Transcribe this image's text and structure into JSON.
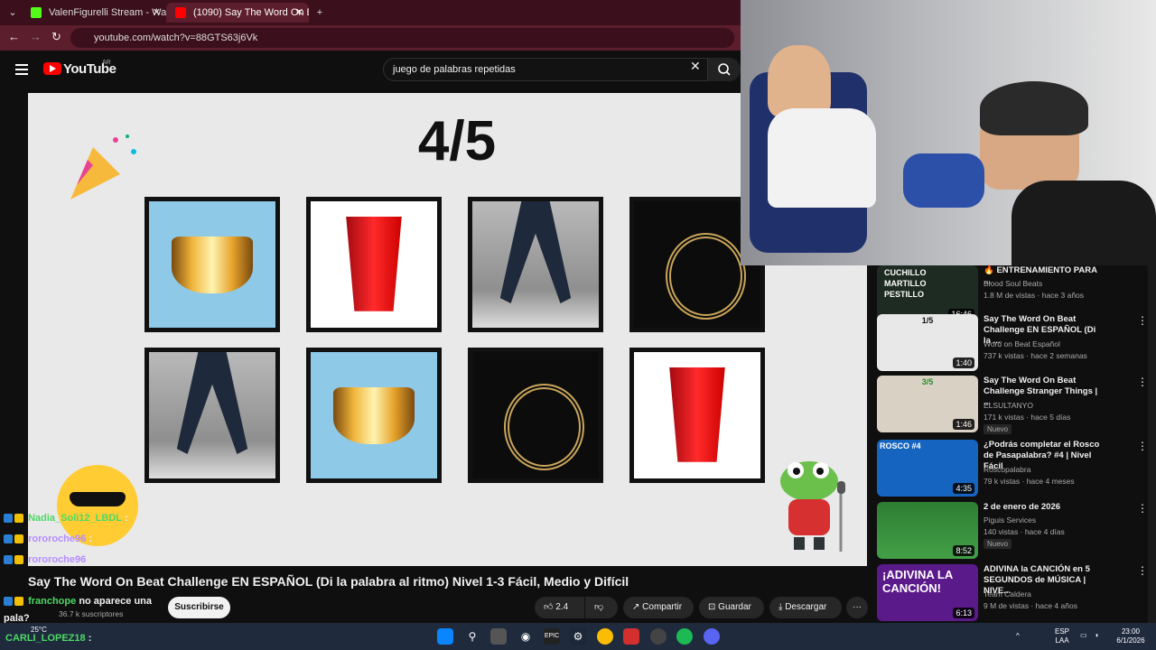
{
  "browser": {
    "tabs": [
      {
        "title": "ValenFigurelli Stream - Watch L"
      },
      {
        "title": "(1090) Say The Word On Be"
      }
    ],
    "new_tab": "+",
    "url": "youtube.com/watch?v=88GTS63j6Vk"
  },
  "youtube": {
    "logo": "YouTube",
    "region": "AR",
    "search_value": "juego de palabras repetidas"
  },
  "video": {
    "score": "4/5",
    "grid": [
      [
        "bowl",
        "cup",
        "walk",
        "rope"
      ],
      [
        "walk",
        "bowl",
        "rope",
        "cup"
      ]
    ]
  },
  "sidebar": {
    "items": [
      {
        "title": "🔥 ENTRENAMIENTO PARA ...",
        "channel": "Blood Soul Beats",
        "meta": "1.8 M de vistas · hace 3 años",
        "duration": "16:46",
        "thumb_text": "CUCHILLO MARTILLO PESTILLO",
        "new": ""
      },
      {
        "title": "Say The Word On Beat Challenge EN ESPAÑOL (Di la ...",
        "channel": "Word on Beat Español",
        "meta": "737 k vistas · hace 2 semanas",
        "duration": "1:40",
        "thumb_text": "1/5",
        "new": ""
      },
      {
        "title": "Say The Word On Beat Challenge Stranger Things | ...",
        "channel": "ELSULTANYO",
        "meta": "171 k vistas · hace 5 días",
        "duration": "1:46",
        "thumb_text": "3/5",
        "new": "Nuevo"
      },
      {
        "title": "¿Podrás completar el Rosco de Pasapalabra? #4 | Nivel Fácil",
        "channel": "Roscopalabra",
        "meta": "79 k vistas · hace 4 meses",
        "duration": "4:35",
        "thumb_text": "ROSCO #4",
        "new": ""
      },
      {
        "title": "2 de enero de 2026",
        "channel": "Piguis Services",
        "meta": "140 vistas · hace 4 días",
        "duration": "8:52",
        "thumb_text": "",
        "new": "Nuevo"
      },
      {
        "title": "ADIVINA la CANCIÓN en 5 SEGUNDOS de MÚSICA | NIVE...",
        "channel": "Team Caldera",
        "meta": "9 M de vistas · hace 4 años",
        "duration": "6:13",
        "thumb_text": "¡ADIVINA LA CANCIÓN!",
        "new": ""
      }
    ]
  },
  "below": {
    "title": "Say The Word On Beat Challenge EN ESPAÑOL (Di la palabra al ritmo) Nivel 1-3 Fácil, Medio y Difícil",
    "subscribers": "36.7 k suscriptores",
    "subscribe": "Suscribirse",
    "likes": "2.4 K",
    "share": "Compartir",
    "save": "Guardar",
    "download": "Descargar",
    "more": "···"
  },
  "chat": [
    {
      "user": "Nadia_Soli12_LBDL",
      "text": ":",
      "color": "#4cd964"
    },
    {
      "user": "rororoche96",
      "text": ":",
      "color": "#b58cff"
    },
    {
      "user": "rororoche96",
      "text": ":",
      "color": "#b58cff"
    },
    {
      "user": "franchope",
      "text": "no aparece una",
      "color": "#4cd964"
    },
    {
      "user": "",
      "text": "pala?",
      "color": "#ffffff"
    },
    {
      "user": "CARLI_LOPEZ18",
      "text": ":",
      "color": "#4cd964"
    }
  ],
  "taskbar": {
    "weather": "25°C",
    "lang": "ESP",
    "lang2": "LAA",
    "time": "23:00",
    "date": "6/1/2026"
  },
  "colors": {
    "yt_red": "#ff0000",
    "tab_bg": "#3b0f1c",
    "addr_bg": "#5c1d2c"
  }
}
